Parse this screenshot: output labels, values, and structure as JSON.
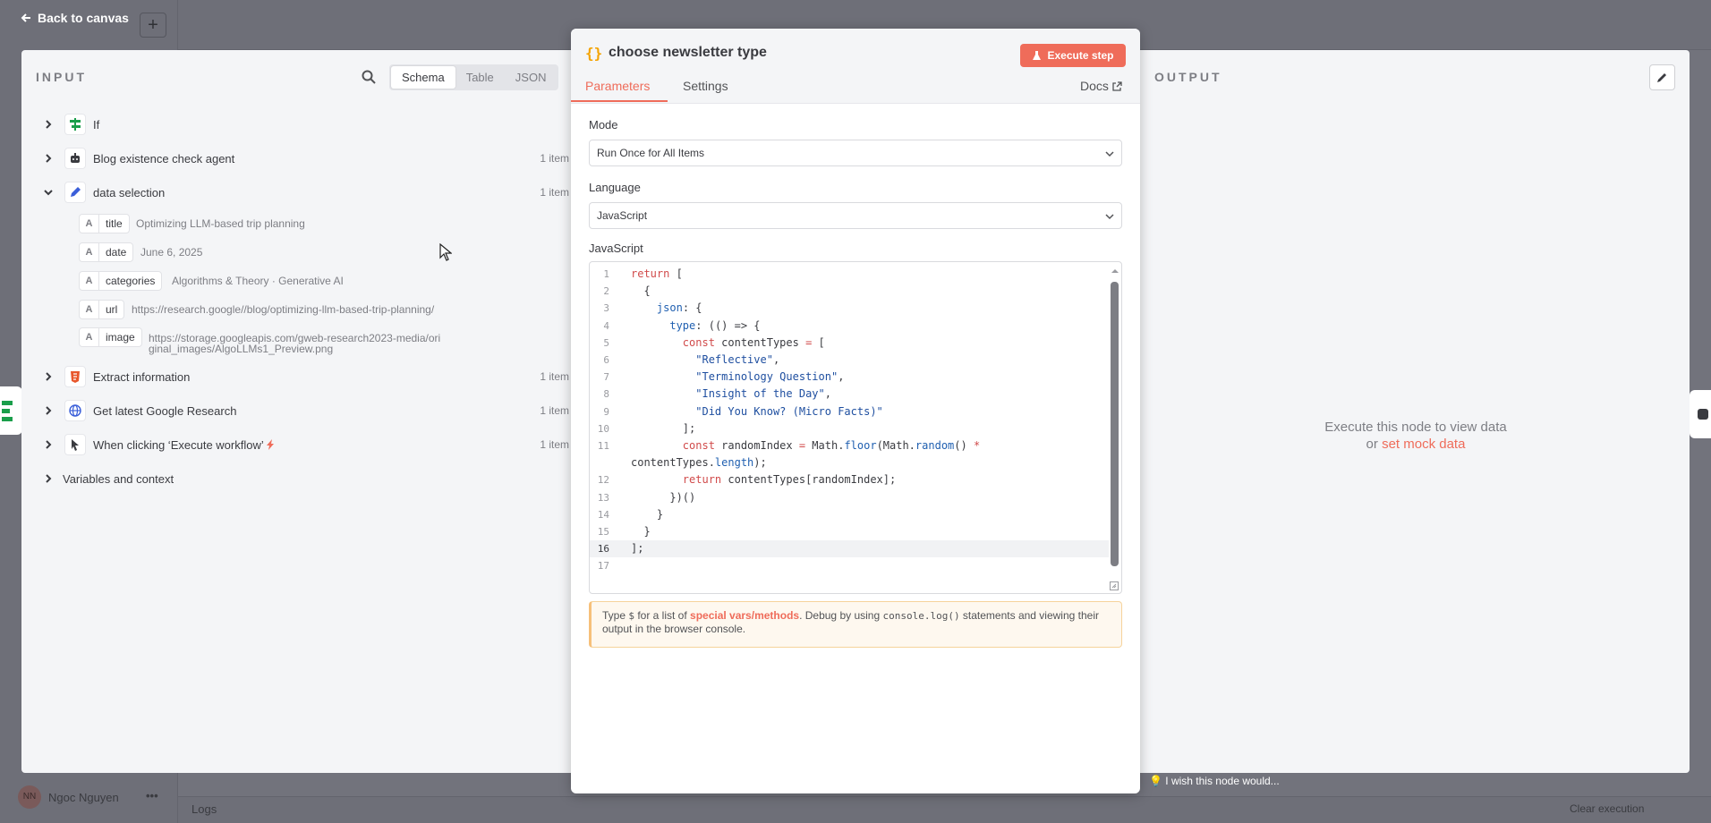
{
  "canvas": {
    "back_label": "Back to canvas",
    "plus": "+",
    "user_name": "Ngoc Nguyen",
    "user_initials": "NN",
    "wish_text": "I wish this node would...",
    "logs_label": "Logs",
    "clear_execution": "Clear execution"
  },
  "input": {
    "title": "INPUT",
    "views": [
      "Schema",
      "Table",
      "JSON"
    ],
    "active_view": "Schema",
    "nodes": [
      {
        "name": "If",
        "count": "",
        "icon": "if-icon",
        "expanded": false
      },
      {
        "name": "Blog existence check agent",
        "count": "1 item",
        "icon": "robot-icon",
        "expanded": false
      },
      {
        "name": "data selection",
        "count": "1 item",
        "icon": "pencil-icon",
        "expanded": true
      }
    ],
    "fields": [
      {
        "type": "A",
        "key": "title",
        "value": "Optimizing LLM-based trip planning"
      },
      {
        "type": "A",
        "key": "date",
        "value": "June 6, 2025"
      },
      {
        "type": "A",
        "key": "categories",
        "value": "Algorithms & Theory · Generative AI"
      },
      {
        "type": "A",
        "key": "url",
        "value": "https://research.google//blog/optimizing-llm-based-trip-planning/"
      },
      {
        "type": "A",
        "key": "image",
        "value": "https://storage.googleapis.com/gweb-research2023-media/original_images/AlgoLLMs1_Preview.png"
      }
    ],
    "more_nodes": [
      {
        "name": "Extract information",
        "count": "1 item",
        "icon": "html-icon"
      },
      {
        "name": "Get latest Google Research",
        "count": "1 item",
        "icon": "globe-icon"
      },
      {
        "name": "When clicking ‘Execute workflow’",
        "count": "1 item",
        "icon": "pointer-icon"
      }
    ],
    "vars_label": "Variables and context"
  },
  "node": {
    "title_icon": "{}",
    "title": "choose newsletter type",
    "execute_label": "Execute step",
    "tabs": [
      "Parameters",
      "Settings"
    ],
    "docs_label": "Docs",
    "mode_label": "Mode",
    "mode_value": "Run Once for All Items",
    "language_label": "Language",
    "language_value": "JavaScript",
    "code_label": "JavaScript",
    "code_lines": [
      "return [",
      "  {",
      "    json: {",
      "      type: (() => {",
      "        const contentTypes = [",
      "          \"Reflective\",",
      "          \"Terminology Question\",",
      "          \"Insight of the Day\",",
      "          \"Did You Know? (Micro Facts)\"",
      "        ];",
      "        const randomIndex = Math.floor(Math.random() *",
      "contentTypes.length);",
      "        return contentTypes[randomIndex];",
      "      })()",
      "    }",
      "  }",
      "];",
      ""
    ],
    "line_numbers": [
      "1",
      "2",
      "3",
      "4",
      "5",
      "6",
      "7",
      "8",
      "9",
      "10",
      "11",
      "",
      "12",
      "13",
      "14",
      "15",
      "16",
      "17"
    ],
    "active_line": "16",
    "hint_pre": "Type ",
    "hint_dollar": "$",
    "hint_mid": " for a list of ",
    "hint_link": "special vars/methods",
    "hint_post": ". Debug by using ",
    "hint_code": "console.log()",
    "hint_end": " statements and viewing their output in the browser console."
  },
  "output": {
    "title": "OUTPUT",
    "message_line1": "Execute this node to view data",
    "message_or": "or ",
    "mock_link": "set mock data"
  },
  "colors": {
    "accent": "#ef6c5a",
    "json_key": "#1f4fa0"
  }
}
